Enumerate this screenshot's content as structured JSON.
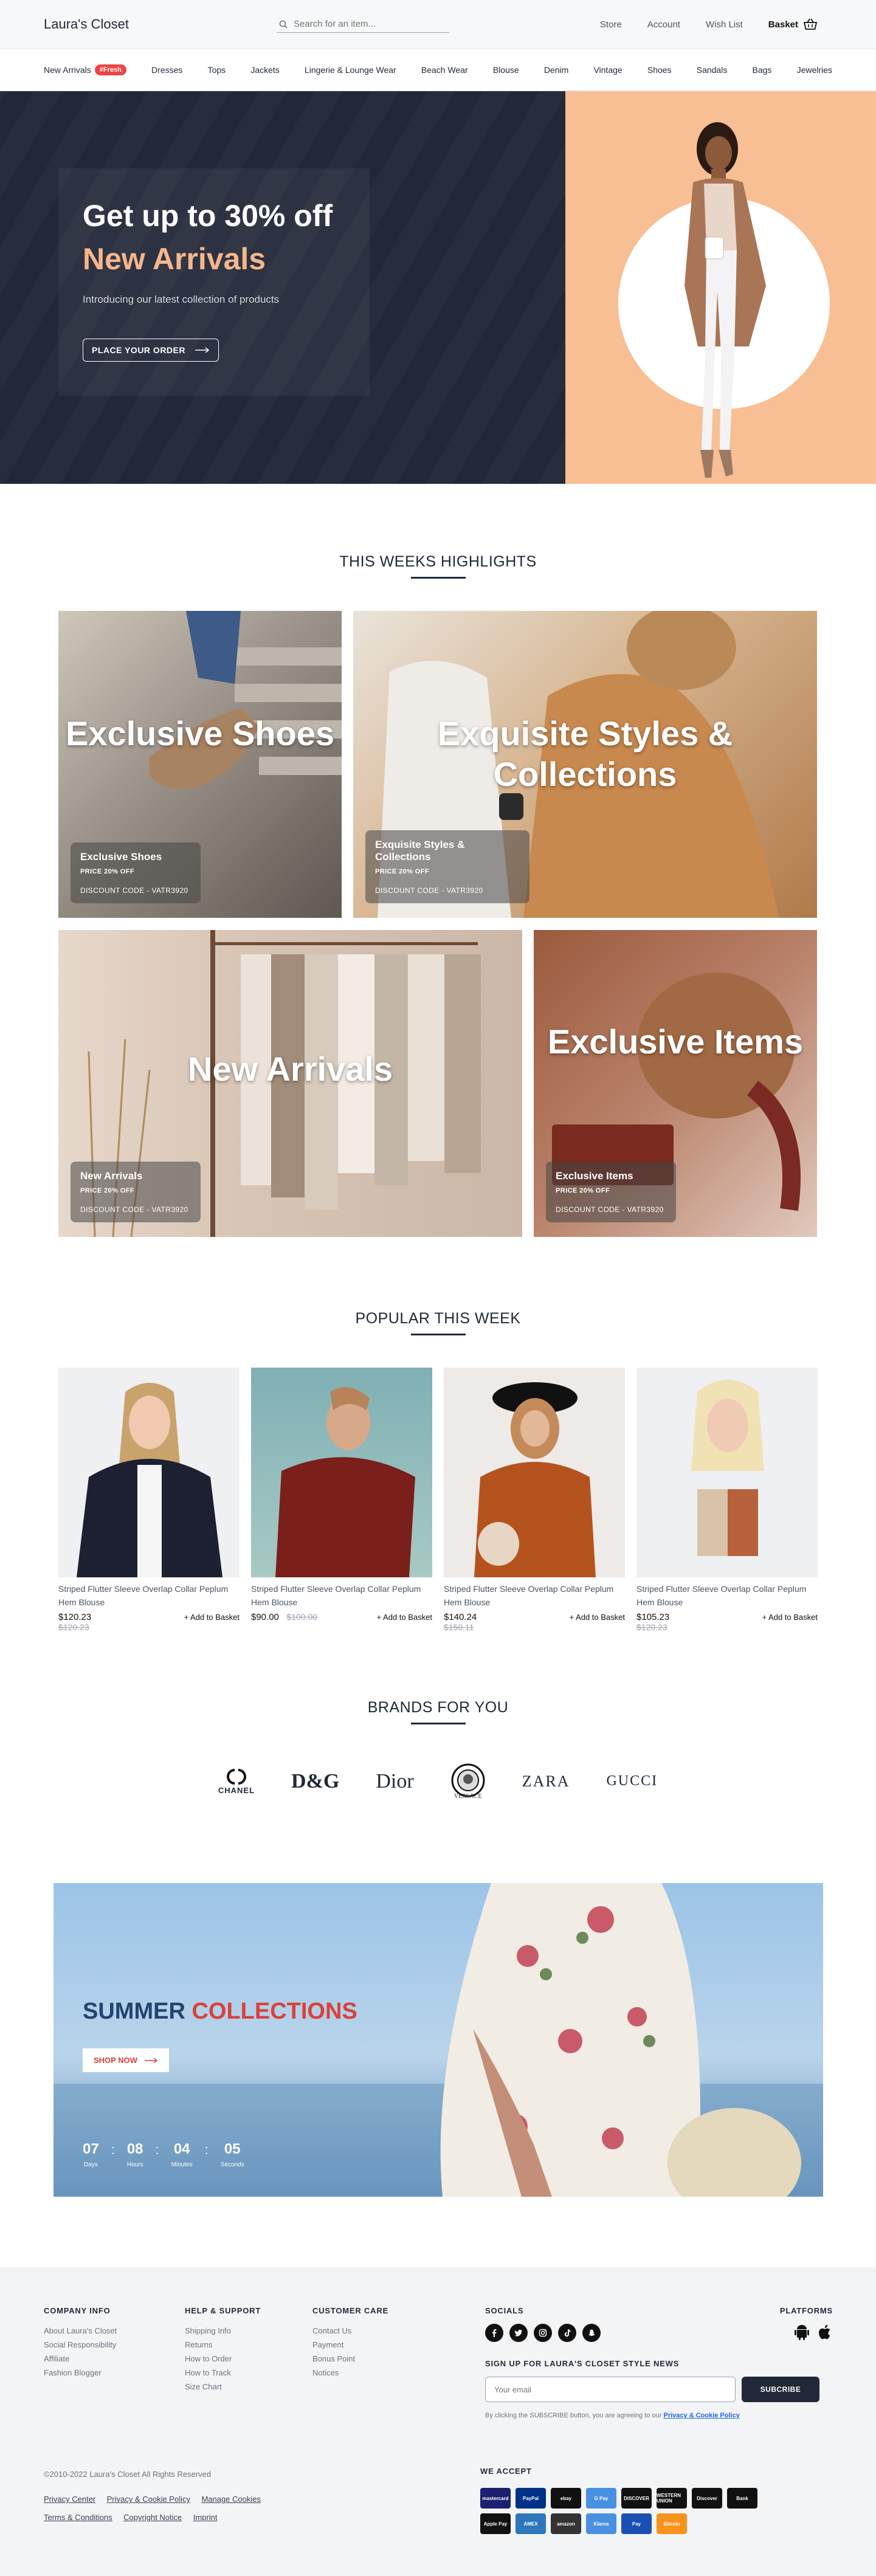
{
  "header": {
    "logo": "Laura's Closet",
    "search_placeholder": "Search for an item...",
    "nav": [
      "Store",
      "Account",
      "Wish List"
    ],
    "basket": "Basket"
  },
  "categories": [
    {
      "label": "New Arrivals",
      "badge": "#Fresh"
    },
    {
      "label": "Dresses"
    },
    {
      "label": "Tops"
    },
    {
      "label": "Jackets"
    },
    {
      "label": "Lingerie & Lounge Wear"
    },
    {
      "label": "Beach Wear"
    },
    {
      "label": "Blouse"
    },
    {
      "label": "Denim"
    },
    {
      "label": "Vintage"
    },
    {
      "label": "Shoes"
    },
    {
      "label": "Sandals"
    },
    {
      "label": "Bags"
    },
    {
      "label": "Jewelries"
    }
  ],
  "hero": {
    "title": "Get up to 30% off",
    "subtitle": "New Arrivals",
    "description": "Introducing our latest collection of products",
    "cta": "PLACE YOUR ORDER"
  },
  "highlights": {
    "title": "THIS WEEKS HIGHLIGHTS",
    "tiles": [
      {
        "big": "Exclusive Shoes",
        "name": "Exclusive Shoes",
        "promo": "PRICE 20% OFF",
        "code": "DISCOUNT CODE - VATR3920"
      },
      {
        "big": "Exquisite Styles & Collections",
        "name": "Exquisite Styles & Collections",
        "promo": "PRICE 20% OFF",
        "code": "DISCOUNT CODE - VATR3920"
      },
      {
        "big": "New Arrivals",
        "name": "New Arrivals",
        "promo": "PRICE 20% OFF",
        "code": "DISCOUNT CODE - VATR3920"
      },
      {
        "big": "Exclusive Items",
        "name": "Exclusive Items",
        "promo": "PRICE 20% OFF",
        "code": "DISCOUNT CODE - VATR3920"
      }
    ]
  },
  "popular": {
    "title": "POPULAR THIS WEEK",
    "add_label": "+ Add to Basket",
    "products": [
      {
        "name": "Striped Flutter Sleeve Overlap Collar Peplum Hem Blouse",
        "price": "$120.23",
        "old": "$120.23"
      },
      {
        "name": "Striped Flutter Sleeve Overlap Collar Peplum Hem Blouse",
        "price": "$90.00",
        "old": "$100.00"
      },
      {
        "name": "Striped Flutter Sleeve Overlap Collar Peplum Hem Blouse",
        "price": "$140.24",
        "old": "$150.11"
      },
      {
        "name": "Striped Flutter Sleeve Overlap Collar Peplum Hem Blouse",
        "price": "$105.23",
        "old": "$120.23"
      }
    ]
  },
  "brands": {
    "title": "BRANDS FOR YOU",
    "items": [
      "CHANEL",
      "D&G",
      "Dior",
      "VERSACE",
      "ZARA",
      "GUCCI"
    ]
  },
  "summer": {
    "title_a": "SUMMER",
    "title_b": "COLLECTIONS",
    "cta": "SHOP NOW",
    "countdown": [
      {
        "value": "07",
        "label": "Days"
      },
      {
        "value": "08",
        "label": "Hours"
      },
      {
        "value": "04",
        "label": "Minutes"
      },
      {
        "value": "05",
        "label": "Seconds"
      }
    ]
  },
  "footer": {
    "company": {
      "title": "COMPANY INFO",
      "links": [
        "About Laura's Closet",
        "Social Responsibility",
        "Affiliate",
        "Fashion Blogger"
      ]
    },
    "help": {
      "title": "HELP & SUPPORT",
      "links": [
        "Shipping Info",
        "Returns",
        "How to Order",
        "How to Track",
        "Size Chart"
      ]
    },
    "care": {
      "title": "CUSTOMER CARE",
      "links": [
        "Contact Us",
        "Payment",
        "Bonus Point",
        "Notices"
      ]
    },
    "socials_title": "SOCIALS",
    "platforms_title": "PLATFORMS",
    "signup_title": "SIGN UP FOR LAURA'S CLOSET  STYLE NEWS",
    "email_placeholder": "Your email",
    "subscribe": "SUBCRIBE",
    "agree_text": "By clicking the SUBSCRIBE button, you are agreeing to our",
    "agree_link": "Privacy & Cookie Policy",
    "copyright": "©2010-2022 Laura's Closet All Rights Reserved",
    "legal_row1": [
      "Privacy Center",
      "Privacy & Cookie Policy",
      "Manage Cookies"
    ],
    "legal_row2": [
      "Terms & Conditions",
      "Copyright Notice",
      "Imprint"
    ],
    "we_accept": "WE ACCEPT",
    "payments": [
      {
        "name": "mastercard",
        "color": "#1a1f71"
      },
      {
        "name": "PayPal",
        "color": "#003087"
      },
      {
        "name": "ebay",
        "color": "#111111"
      },
      {
        "name": "G Pay",
        "color": "#4a90e2"
      },
      {
        "name": "DISCOVER",
        "color": "#111111"
      },
      {
        "name": "WESTERN UNION",
        "color": "#111111"
      },
      {
        "name": "Discover",
        "color": "#111111"
      },
      {
        "name": "Bank",
        "color": "#111111"
      },
      {
        "name": "Apple Pay",
        "color": "#111111"
      },
      {
        "name": "AMEX",
        "color": "#2e77bc"
      },
      {
        "name": "amazon",
        "color": "#333333"
      },
      {
        "name": "Klarna",
        "color": "#4a90e2"
      },
      {
        "name": "Pay",
        "color": "#1a4fb4"
      },
      {
        "name": "Bitcoin",
        "color": "#f7931a"
      }
    ]
  }
}
